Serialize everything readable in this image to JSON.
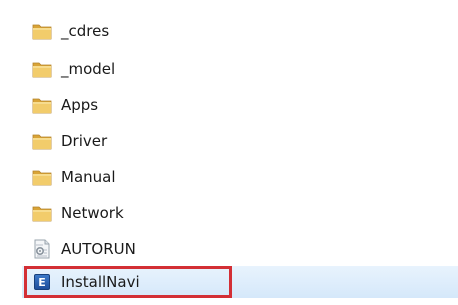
{
  "files": [
    {
      "name": "_cdres",
      "icon": "folder-icon"
    },
    {
      "name": "_model",
      "icon": "folder-icon"
    },
    {
      "name": "Apps",
      "icon": "folder-icon"
    },
    {
      "name": "Driver",
      "icon": "folder-icon"
    },
    {
      "name": "Manual",
      "icon": "folder-icon"
    },
    {
      "name": "Network",
      "icon": "folder-icon"
    },
    {
      "name": "AUTORUN",
      "icon": "settings-file-icon"
    },
    {
      "name": "InstallNavi",
      "icon": "application-icon",
      "selected": true,
      "icon_letter": "E"
    }
  ],
  "colors": {
    "folder": "#e8b64a",
    "selection": "#d5e8fa",
    "highlight_border": "#d32f35",
    "app_icon": "#2a5fb0"
  }
}
